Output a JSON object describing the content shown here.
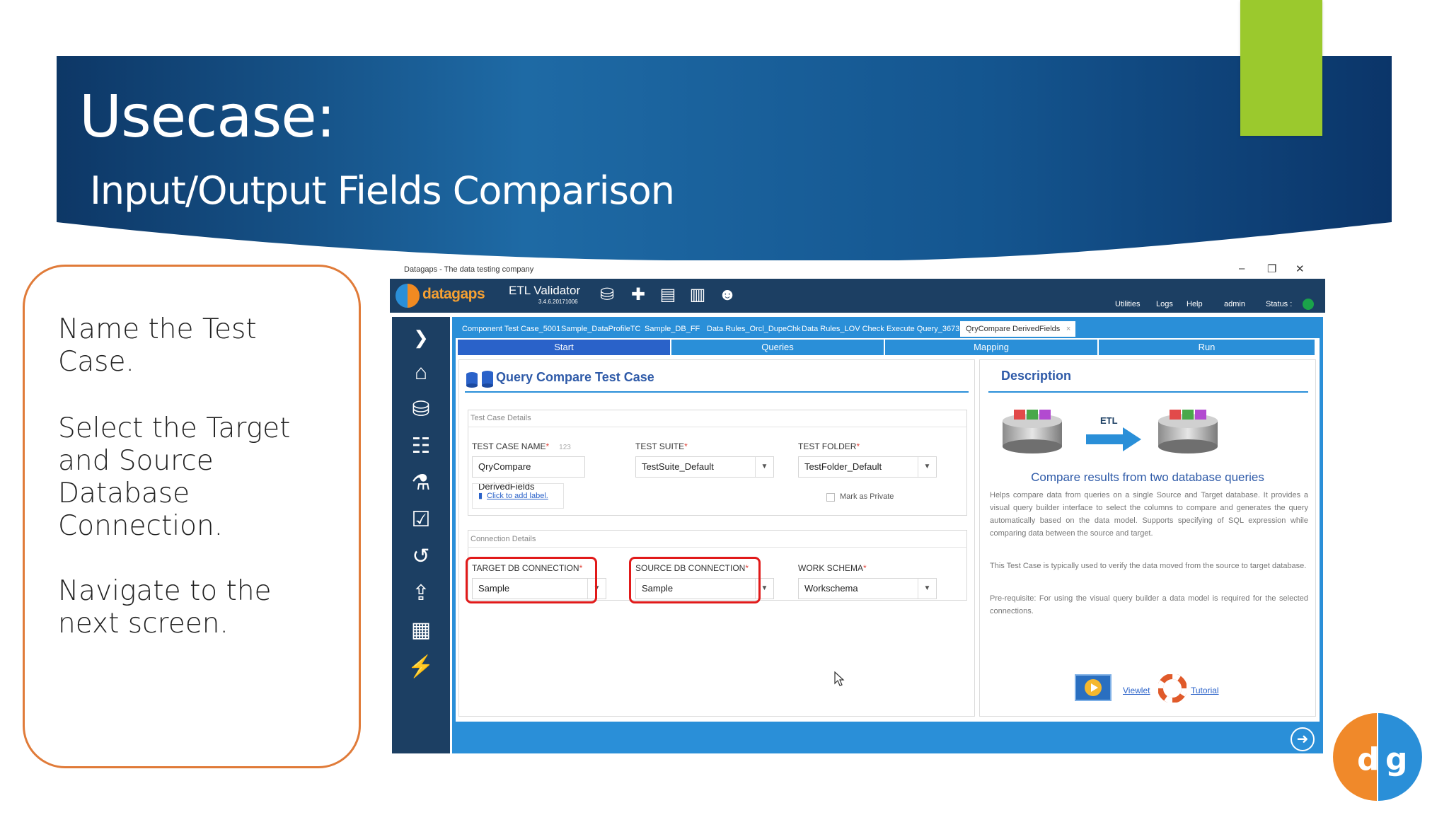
{
  "slide": {
    "title": "Usecase:",
    "subtitle": "Input/Output Fields Comparison",
    "steps": [
      "Name the Test Case.",
      "Select the Target and Source Database Connection.",
      "Navigate to the next screen."
    ]
  },
  "window": {
    "title": "Datagaps - The data testing company",
    "controls": {
      "minimize": "–",
      "restore": "❐",
      "close": "✕"
    }
  },
  "app_header": {
    "logo_text": "datagaps",
    "product_name": "ETL Validator",
    "product_version": "3.4.6.20171006",
    "menu": [
      "Utilities",
      "Logs",
      "Help",
      "admin",
      "Status :"
    ]
  },
  "doc_tabs": [
    "Component Test Case_5001",
    "Sample_DataProfileTC",
    "Sample_DB_FF",
    "Data Rules_Orcl_DupeChk",
    "Data Rules_LOV Check",
    "Execute Query_3673",
    "QryCompare DerivedFields"
  ],
  "doc_tab_close": "×",
  "wizard_steps": [
    "Start",
    "Queries",
    "Mapping",
    "Run"
  ],
  "form": {
    "panel_title": "Query Compare Test Case",
    "test_case_details_label": "Test Case Details",
    "test_case_name_label": "TEST CASE NAME",
    "test_case_name_counter": "123",
    "test_case_name_value": "QryCompare DerivedFields",
    "test_suite_label": "TEST SUITE",
    "test_suite_value": "TestSuite_Default",
    "test_folder_label": "TEST FOLDER",
    "test_folder_value": "TestFolder_Default",
    "add_label_link": "Click to add label.",
    "mark_private_label": "Mark as Private",
    "connection_details_label": "Connection Details",
    "target_db_label": "TARGET DB CONNECTION",
    "target_db_value": "Sample",
    "source_db_label": "SOURCE DB CONNECTION",
    "source_db_value": "Sample",
    "work_schema_label": "WORK SCHEMA",
    "work_schema_value": "Workschema",
    "required_marker": "*"
  },
  "description": {
    "title": "Description",
    "etl_label": "ETL",
    "heading": "Compare results from two database queries",
    "para1": "Helps compare data from queries on a single Source and Target database. It provides a visual query builder interface to select the columns to compare and generates the query automatically based on the data model. Supports specifying of SQL expression while comparing data between the source and target.",
    "para2": "This Test Case is typically used to verify the data moved from the source to target database.",
    "para3": "Pre-requisite: For using the visual query builder a data model is required for the selected connections.",
    "viewlet_link": "Viewlet",
    "tutorial_link": "Tutorial"
  },
  "colors": {
    "banner_dark": "#0f3a66",
    "banner_mid": "#1f6aa8",
    "accent_green": "#9bc92d",
    "callout_border": "#e07b39",
    "app_navy": "#1c3f63",
    "app_blue": "#2a8fd8",
    "highlight_red": "#e11a1a"
  }
}
